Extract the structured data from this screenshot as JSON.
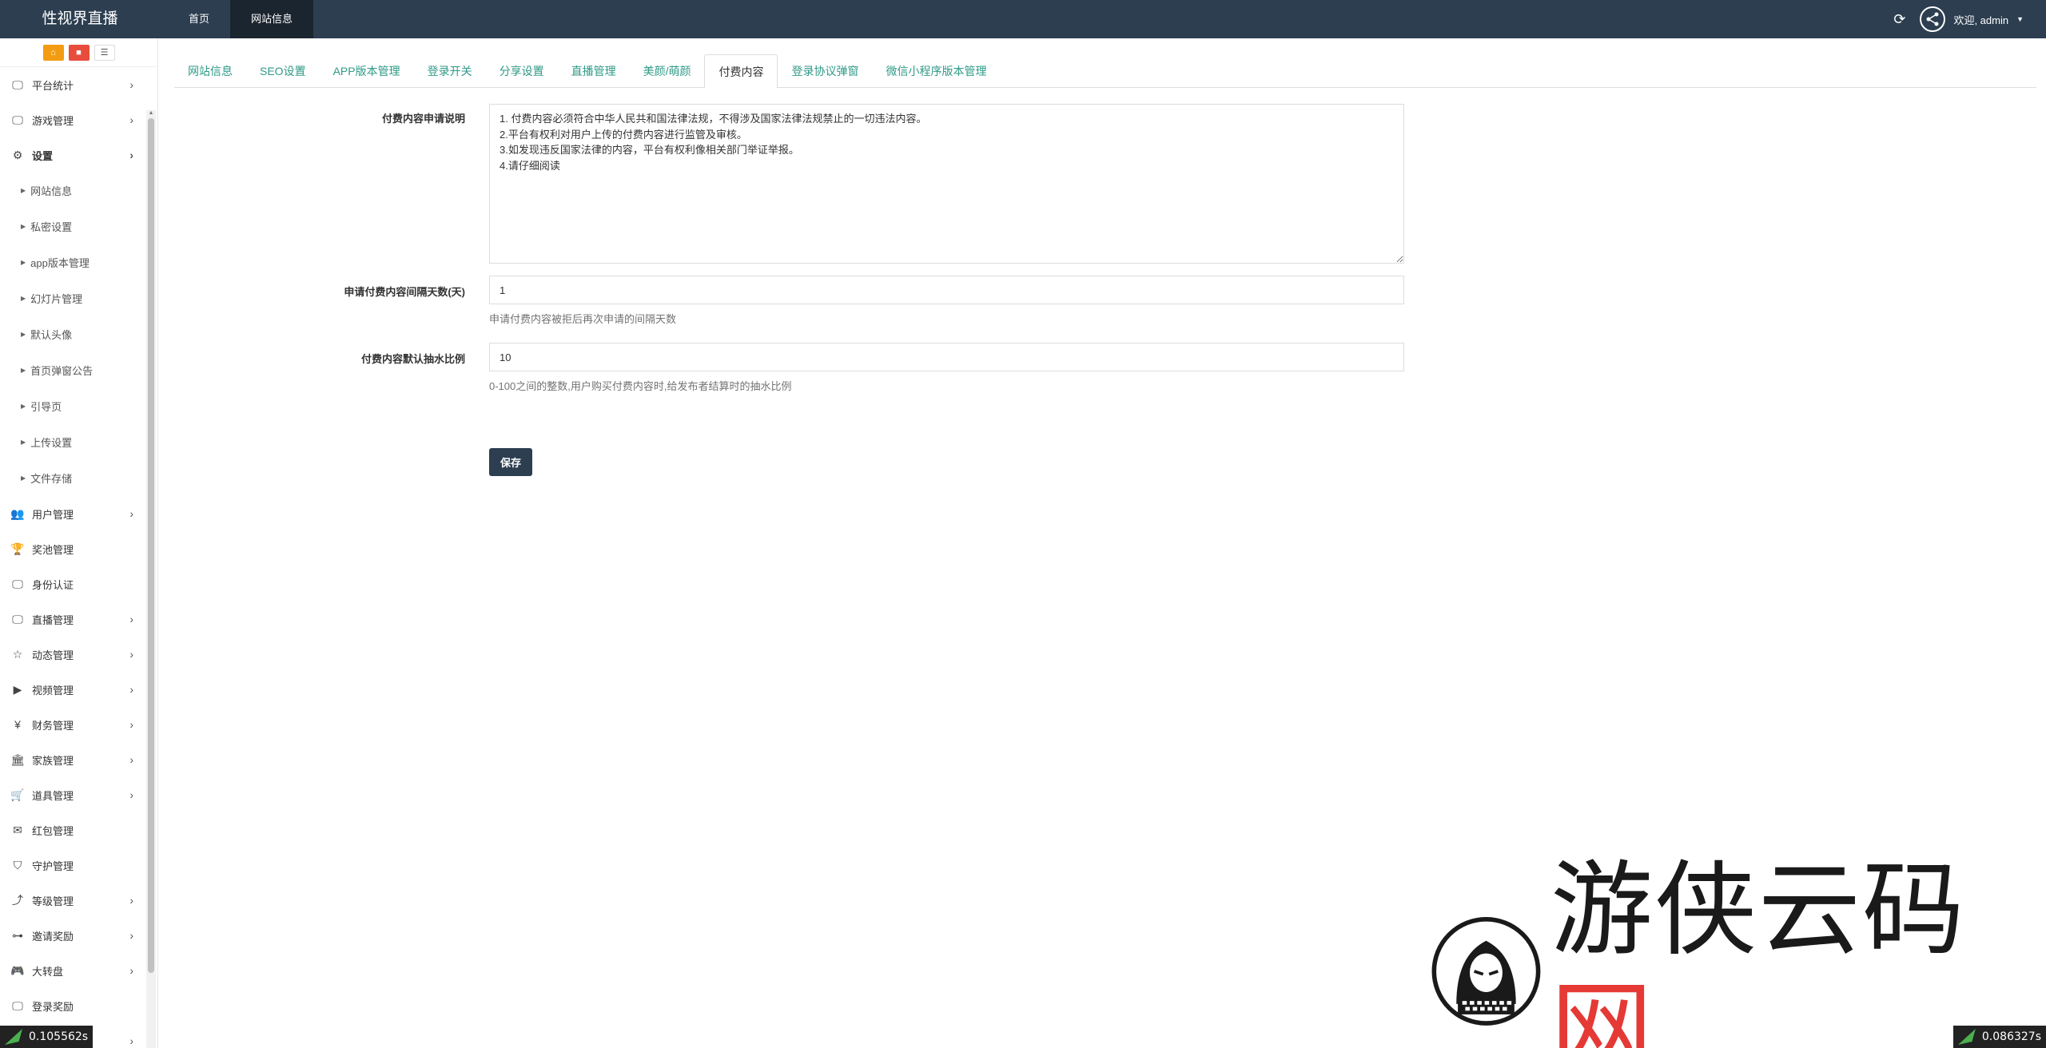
{
  "brand": "性视界直播",
  "topnav": [
    {
      "label": "首页",
      "active": false
    },
    {
      "label": "网站信息",
      "active": true
    }
  ],
  "user": {
    "welcome": "欢迎, admin"
  },
  "sidebar": {
    "items": [
      {
        "label": "平台统计",
        "icon": "monitor-icon",
        "has_children": true
      },
      {
        "label": "游戏管理",
        "icon": "monitor-icon",
        "has_children": true
      },
      {
        "label": "设置",
        "icon": "gears-icon",
        "has_children": true,
        "open": true
      },
      {
        "label": "网站信息",
        "sub": true
      },
      {
        "label": "私密设置",
        "sub": true
      },
      {
        "label": "app版本管理",
        "sub": true
      },
      {
        "label": "幻灯片管理",
        "sub": true
      },
      {
        "label": "默认头像",
        "sub": true
      },
      {
        "label": "首页弹窗公告",
        "sub": true
      },
      {
        "label": "引导页",
        "sub": true
      },
      {
        "label": "上传设置",
        "sub": true
      },
      {
        "label": "文件存储",
        "sub": true
      },
      {
        "label": "用户管理",
        "icon": "users-icon",
        "has_children": true
      },
      {
        "label": "奖池管理",
        "icon": "trophy-icon",
        "has_children": false
      },
      {
        "label": "身份认证",
        "icon": "monitor-icon",
        "has_children": false
      },
      {
        "label": "直播管理",
        "icon": "monitor-icon",
        "has_children": true
      },
      {
        "label": "动态管理",
        "icon": "star-icon",
        "has_children": true
      },
      {
        "label": "视频管理",
        "icon": "video-icon",
        "has_children": true
      },
      {
        "label": "财务管理",
        "icon": "yen-icon",
        "has_children": true
      },
      {
        "label": "家族管理",
        "icon": "bank-icon",
        "has_children": true
      },
      {
        "label": "道具管理",
        "icon": "cart-icon",
        "has_children": true
      },
      {
        "label": "红包管理",
        "icon": "envelope-icon",
        "has_children": false
      },
      {
        "label": "守护管理",
        "icon": "shield-icon",
        "has_children": false
      },
      {
        "label": "等级管理",
        "icon": "level-icon",
        "has_children": true
      },
      {
        "label": "邀请奖励",
        "icon": "sitemap-icon",
        "has_children": true
      },
      {
        "label": "大转盘",
        "icon": "gamepad-icon",
        "has_children": true
      },
      {
        "label": "登录奖励",
        "icon": "monitor-icon",
        "has_children": false
      },
      {
        "label": "",
        "icon": "",
        "has_children": true
      }
    ]
  },
  "tabs": [
    {
      "label": "网站信息",
      "active": false
    },
    {
      "label": "SEO设置",
      "active": false
    },
    {
      "label": "APP版本管理",
      "active": false
    },
    {
      "label": "登录开关",
      "active": false
    },
    {
      "label": "分享设置",
      "active": false
    },
    {
      "label": "直播管理",
      "active": false
    },
    {
      "label": "美颜/萌颜",
      "active": false
    },
    {
      "label": "付费内容",
      "active": true
    },
    {
      "label": "登录协议弹窗",
      "active": false
    },
    {
      "label": "微信小程序版本管理",
      "active": false
    }
  ],
  "form": {
    "desc_label": "付费内容申请说明",
    "desc_value": "1. 付费内容必须符合中华人民共和国法律法规，不得涉及国家法律法规禁止的一切违法内容。\n2.平台有权利对用户上传的付费内容进行监管及审核。\n3.如发现违反国家法律的内容，平台有权利像相关部门举证举报。\n4.请仔细阅读",
    "days_label": "申请付费内容间隔天数(天)",
    "days_value": "1",
    "days_help": "申请付费内容被拒后再次申请的间隔天数",
    "ratio_label": "付费内容默认抽水比例",
    "ratio_value": "10",
    "ratio_help": "0-100之间的整数,用户购买付费内容时,给发布者结算时的抽水比例",
    "save_label": "保存"
  },
  "watermark": {
    "text": "游侠云码",
    "accent": "网"
  },
  "timers": {
    "left": "0.105562s",
    "right": "0.086327s"
  },
  "colors": {
    "topbar": "#2c3e50",
    "tab_link": "#2f9a87",
    "accent_red": "#e74c3c",
    "shortcut_orange": "#f39c12"
  }
}
